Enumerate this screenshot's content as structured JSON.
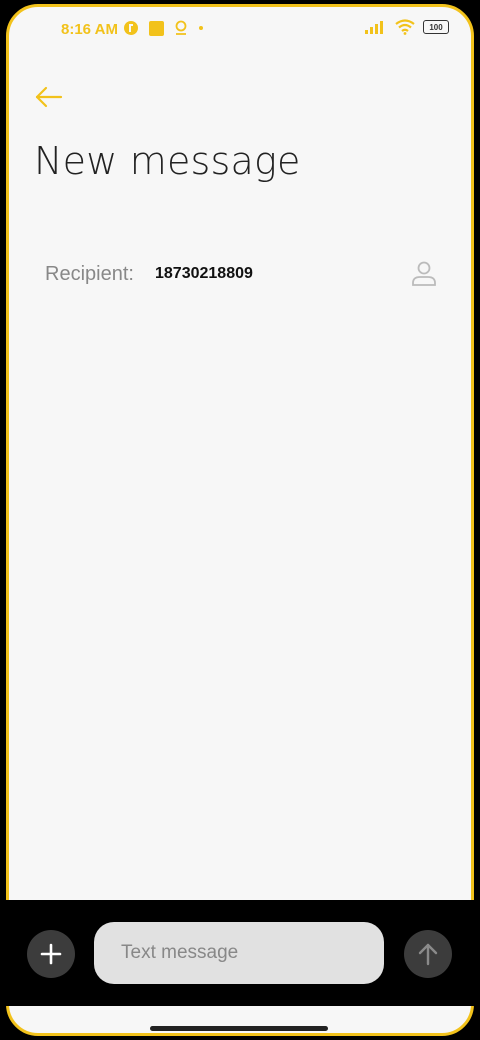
{
  "status_bar": {
    "time": "8:16 AM",
    "battery": "100",
    "icons": [
      "notification-app-icon",
      "yellow-square-icon",
      "location-pin-icon",
      "dot-icon",
      "signal-icon",
      "wifi-icon",
      "battery-icon"
    ]
  },
  "header": {
    "back_icon": "arrow-left-icon",
    "title": "New message"
  },
  "recipient": {
    "label": "Recipient:",
    "value": "18730218809",
    "contact_icon": "person-icon"
  },
  "compose": {
    "add_icon": "plus-icon",
    "placeholder": "Text message",
    "value": "",
    "send_icon": "arrow-up-icon"
  },
  "colors": {
    "accent": "#f2c21b",
    "background": "#f7f7f7",
    "compose_bar": "#000000",
    "button_bg": "#3c3c3c",
    "input_bg": "#e1e1e1"
  }
}
